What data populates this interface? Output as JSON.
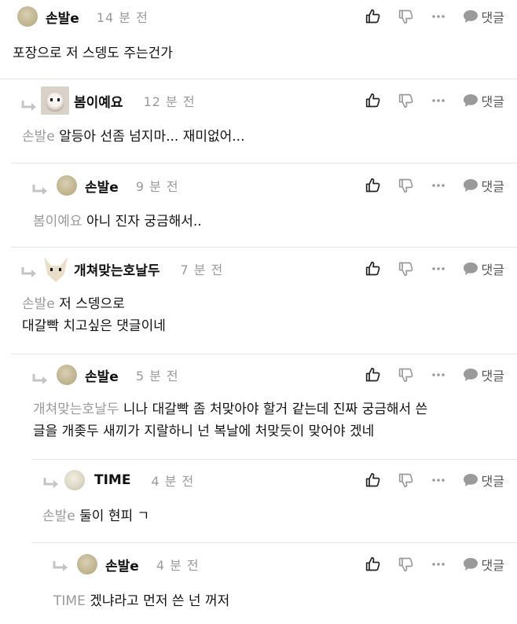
{
  "actions": {
    "reply_label": "댓글"
  },
  "comments": [
    {
      "username": "손발e",
      "time": "14 분 전",
      "mention": "",
      "text": "포장으로 저 스뎅도 주는건가",
      "text2": ""
    },
    {
      "username": "봄이예요",
      "time": "12 분 전",
      "mention": "손발e",
      "text": "알등아 선좀 넘지마... 재미없어...",
      "text2": ""
    },
    {
      "username": "손발e",
      "time": "9 분 전",
      "mention": "봄이예요",
      "text": "아니 진자 궁금해서..",
      "text2": ""
    },
    {
      "username": "개쳐맞는호날두",
      "time": "7 분 전",
      "mention": "손발e",
      "text": "저 스뎅으로",
      "text2": "대갈빡 치고싶은 댓글이네"
    },
    {
      "username": "손발e",
      "time": "5 분 전",
      "mention": "개쳐맞는호날두",
      "text": "니나 대갈빡 좀 처맞아야 할거 같는데 진짜 궁금해서 쓴",
      "text2": "글을 개좆두 새끼가 지랄하니 넌 복날에 처맞듯이 맞어야 겠네"
    },
    {
      "username": "TIME",
      "time": "4 분 전",
      "mention": "손발e",
      "text": "둘이 현피 ㄱ",
      "text2": ""
    },
    {
      "username": "손발e",
      "time": "4 분 전",
      "mention": "TIME",
      "text": "겠냐라고 먼저 쓴 넌 꺼저",
      "text2": ""
    }
  ]
}
